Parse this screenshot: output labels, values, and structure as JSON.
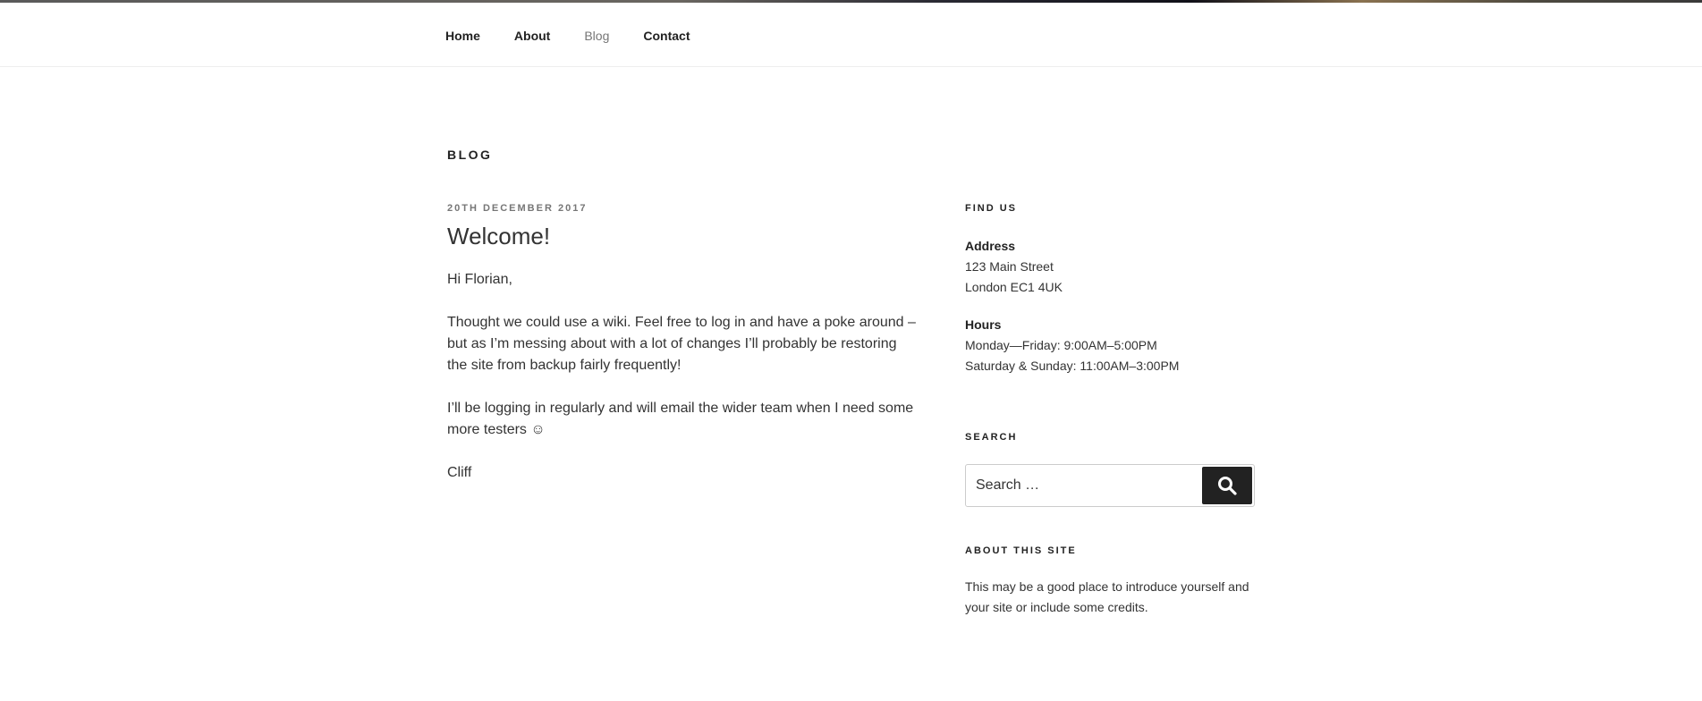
{
  "nav": {
    "items": [
      {
        "label": "Home"
      },
      {
        "label": "About"
      },
      {
        "label": "Blog"
      },
      {
        "label": "Contact"
      }
    ],
    "current_index": 2
  },
  "page": {
    "title": "Blog"
  },
  "post": {
    "date": "20th December 2017",
    "title": "Welcome!",
    "paragraphs": [
      "Hi Florian,",
      "Thought we could use a wiki.  Feel free to log in and have a poke around – but as I’m messing about with a lot of changes I’ll probably be restoring the site from backup fairly frequently!",
      "I’ll be logging in regularly and will email the wider team when I need some more testers ☺",
      "Cliff"
    ]
  },
  "sidebar": {
    "find_us": {
      "title": "Find Us",
      "address_label": "Address",
      "address_line1": "123 Main Street",
      "address_line2": "London EC1 4UK",
      "hours_label": "Hours",
      "hours_line1": "Monday—Friday: 9:00AM–5:00PM",
      "hours_line2": "Saturday & Sunday: 11:00AM–3:00PM"
    },
    "search": {
      "title": "Search",
      "placeholder": "Search …",
      "icon": "search-icon"
    },
    "about": {
      "title": "About This Site",
      "text": "This may be a good place to introduce yourself and your site or include some credits."
    }
  },
  "colors": {
    "text": "#222222",
    "muted": "#767676",
    "button_bg": "#222222"
  }
}
